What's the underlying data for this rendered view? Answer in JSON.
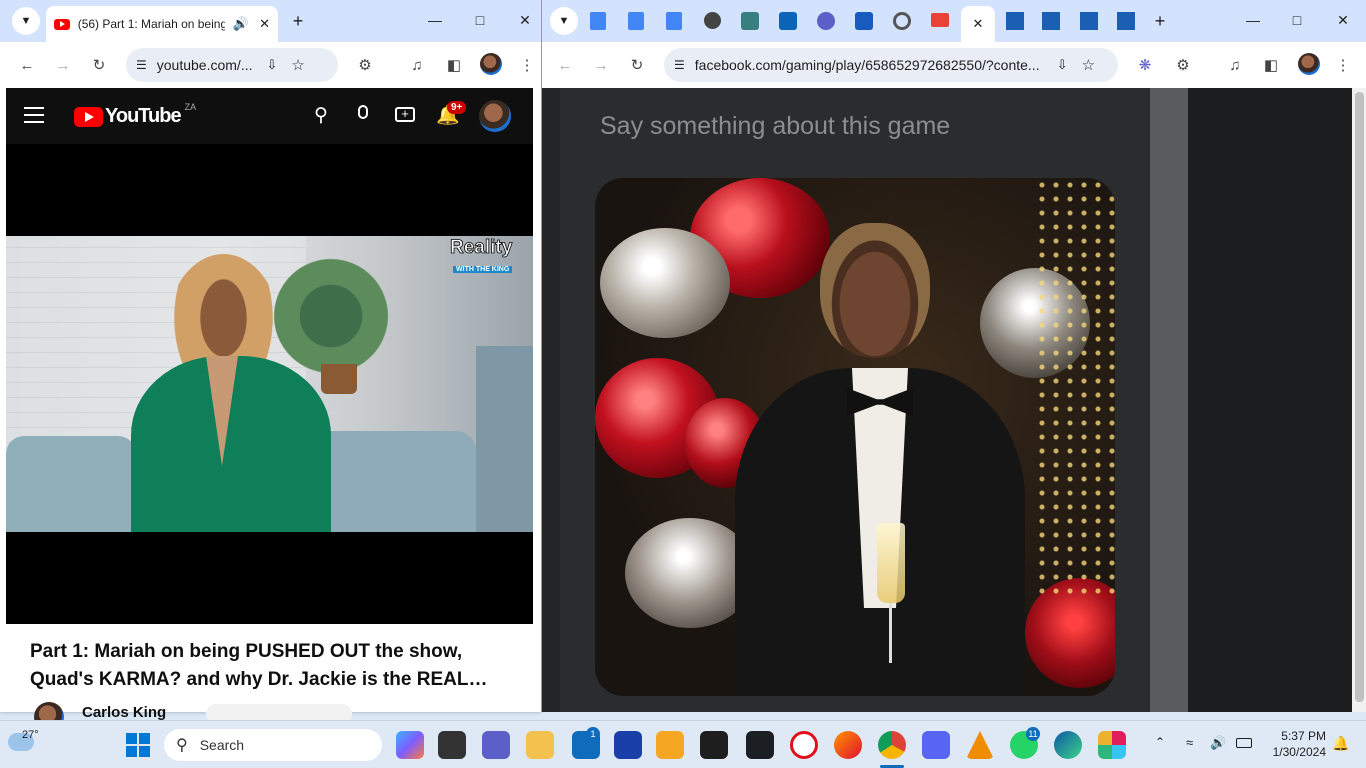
{
  "left_browser": {
    "tab_title": "(56) Part 1: Mariah on being",
    "url": "youtube.com/...",
    "youtube": {
      "logo_text": "YouTube",
      "region": "ZA",
      "notification_count": "9+",
      "video_watermark_line1": "Reality",
      "video_watermark_line2": "WITH THE KING",
      "video_title": "Part 1: Mariah on being PUSHED OUT the show, Quad's KARMA? and why Dr. Jackie is the REAL…",
      "channel_name": "Carlos King"
    }
  },
  "right_browser": {
    "url": "facebook.com/gaming/play/658652972682550/?conte...",
    "facebook": {
      "comment_placeholder": "Say something about this game"
    }
  },
  "taskbar": {
    "weather_temp": "27°",
    "search_placeholder": "Search",
    "time": "5:37 PM",
    "date": "1/30/2024",
    "badges": {
      "store": "1",
      "whatsapp": "11"
    }
  },
  "colors": {
    "youtube_red": "#ff0000",
    "chrome_tabstrip": "#d3e3fd",
    "facebook_dark": "#242526"
  }
}
